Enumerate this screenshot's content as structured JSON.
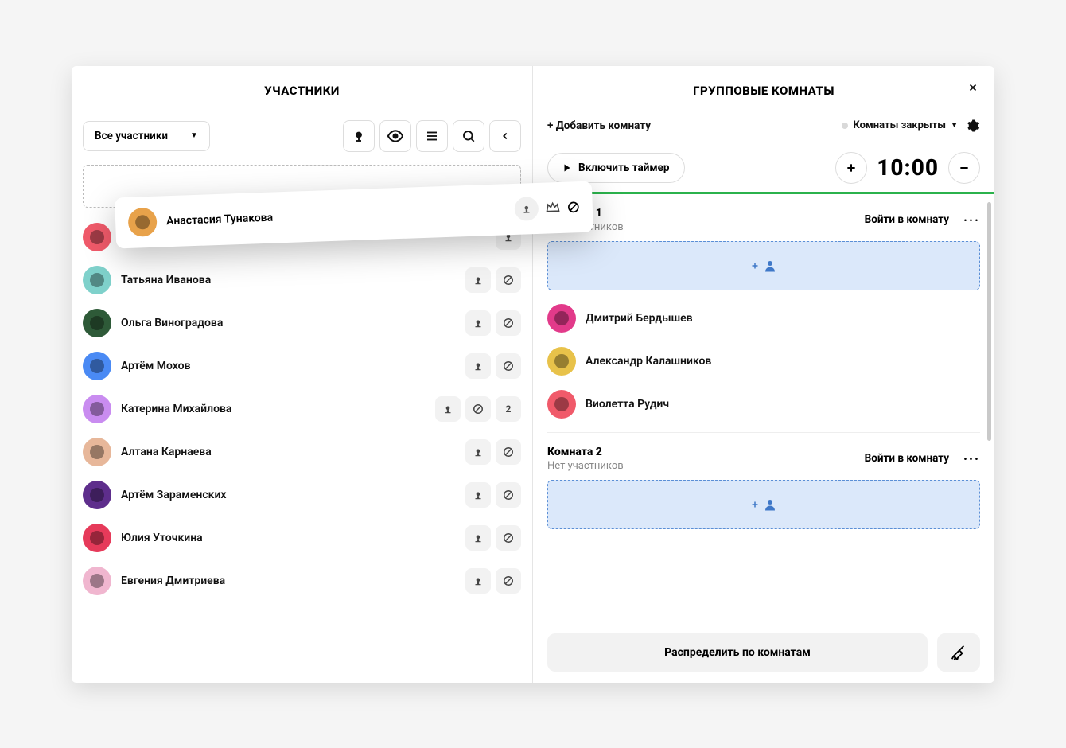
{
  "left": {
    "title": "УЧАСТНИКИ",
    "filter": "Все участники",
    "participants": [
      {
        "name": "Виолетта Рудич",
        "color": "#f05a6a",
        "showCam": true,
        "block": false,
        "badge": null
      },
      {
        "name": "Татьяна Иванова",
        "color": "#7fd1cb",
        "showCam": true,
        "block": true,
        "badge": null
      },
      {
        "name": "Ольга Виноградова",
        "color": "#2e5a38",
        "showCam": true,
        "block": true,
        "badge": null
      },
      {
        "name": "Артём Мохов",
        "color": "#4a8af4",
        "showCam": true,
        "block": true,
        "badge": null
      },
      {
        "name": "Катерина Михайлова",
        "color": "#c98cf0",
        "showCam": true,
        "block": true,
        "badge": "2"
      },
      {
        "name": "Алтана Карнаева",
        "color": "#e7b79a",
        "showCam": true,
        "block": true,
        "badge": null
      },
      {
        "name": "Артём Зараменских",
        "color": "#5e2e8c",
        "showCam": true,
        "block": true,
        "badge": null
      },
      {
        "name": "Юлия Уточкина",
        "color": "#e63a5a",
        "showCam": true,
        "block": true,
        "badge": null
      },
      {
        "name": "Евгения Дмитриева",
        "color": "#f0b6cf",
        "showCam": true,
        "block": true,
        "badge": null
      }
    ],
    "dragged": {
      "name": "Анастасия Тунакова",
      "color": "#e8a24a"
    }
  },
  "right": {
    "title": "ГРУППОВЫЕ КОМНАТЫ",
    "add_room_label": "+ Добавить комнату",
    "status_label": "Комнаты закрыты",
    "timer_toggle_label": "Включить таймер",
    "timer_value": "10:00",
    "rooms": [
      {
        "title": "Комната 1",
        "sub": "Нет участников",
        "enter_label": "Войти в комнату",
        "members": [
          {
            "name": "Дмитрий Бердышев",
            "color": "#e23a8a"
          },
          {
            "name": "Александр Калашников",
            "color": "#e8c24a"
          },
          {
            "name": "Виолетта Рудич",
            "color": "#f05a6a"
          }
        ]
      },
      {
        "title": "Комната 2",
        "sub": "Нет участников",
        "enter_label": "Войти в комнату",
        "members": []
      }
    ],
    "distribute_label": "Распределить по комнатам"
  }
}
